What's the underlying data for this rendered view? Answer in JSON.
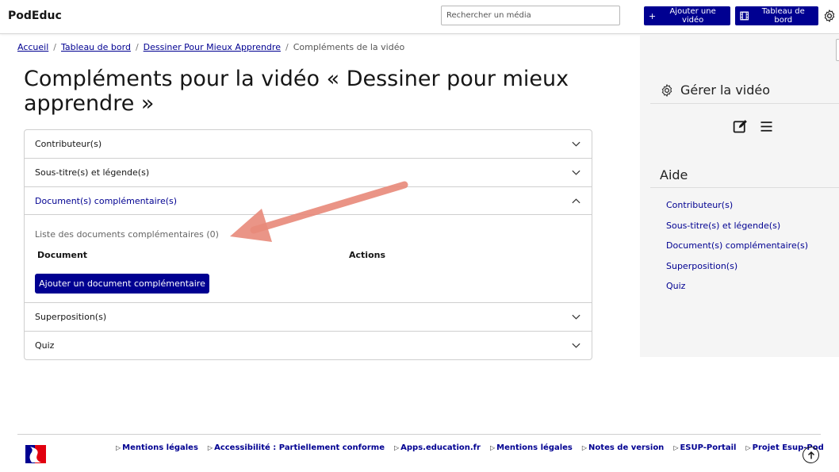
{
  "header": {
    "brand": "PodEduc",
    "search_placeholder": "Rechercher un média",
    "add_video_label": "Ajouter une vidéo",
    "dashboard_label": "Tableau de bord"
  },
  "breadcrumb": {
    "items": [
      "Accueil",
      "Tableau de bord",
      "Dessiner Pour Mieux Apprendre"
    ],
    "current": "Compléments de la vidéo"
  },
  "page": {
    "title": "Compléments pour la vidéo « Dessiner pour mieux apprendre »"
  },
  "accordion": {
    "sections": [
      {
        "label": "Contributeur(s)",
        "open": false
      },
      {
        "label": "Sous-titre(s) et légende(s)",
        "open": false
      },
      {
        "label": "Document(s) complémentaire(s)",
        "open": true
      },
      {
        "label": "Superposition(s)",
        "open": false
      },
      {
        "label": "Quiz",
        "open": false
      }
    ],
    "documents": {
      "list_title": "Liste des documents complémentaires (0)",
      "col_document": "Document",
      "col_actions": "Actions",
      "add_button": "Ajouter un document complémentaire"
    }
  },
  "sidebar": {
    "manage_title": "Gérer la vidéo",
    "help_title": "Aide",
    "help_links": [
      "Contributeur(s)",
      "Sous-titre(s) et légende(s)",
      "Document(s) complémentaire(s)",
      "Superposition(s)",
      "Quiz"
    ]
  },
  "footer": {
    "links": [
      "Mentions légales",
      "Accessibilité : Partiellement conforme",
      "Apps.education.fr",
      "Mentions légales",
      "Notes de version",
      "ESUP-Portail",
      "Projet Esup-Pod"
    ]
  },
  "colors": {
    "primary": "#000091",
    "annotation_arrow": "#e8897a",
    "sidebar_bg": "#f5f5f5"
  },
  "icons": {
    "add": "plus-icon",
    "dashboard": "film-icon",
    "settings": "gear-icon",
    "edit": "edit-icon",
    "menu": "menu-icon",
    "chevron": "chevron-icon",
    "back_to_top": "arrow-up-icon"
  }
}
